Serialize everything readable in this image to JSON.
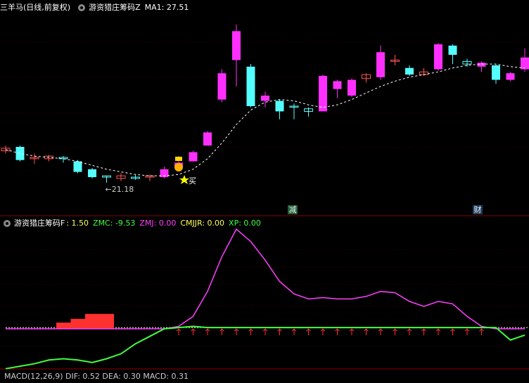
{
  "main_pane": {
    "stock_title": "三羊马(日线,前复权)",
    "indicator_name": "游资猎庄筹码Z",
    "ma_label": "MA1: 27.51",
    "low_marker": "←21.18",
    "buy_label": "买",
    "event_badges": [
      "减",
      "财"
    ]
  },
  "sub_pane": {
    "indicator_name": "游资猎庄筹码F",
    "items": [
      {
        "text": ": 1.50",
        "color": "#ffff54"
      },
      {
        "text": "ZMC: -9.53",
        "color": "#40ff40"
      },
      {
        "text": "ZMJ: 0.00",
        "color": "#ff40ff"
      },
      {
        "text": "CMJJR: 0.00",
        "color": "#ffff54"
      },
      {
        "text": "XP: 0.00",
        "color": "#40ff40"
      }
    ]
  },
  "bottom_pane": {
    "partial_legend": "MACD(12,26,9) DIF: 0.52 DEA: 0.30 MACD: 0.31"
  },
  "colors": {
    "up": "#ff30ff",
    "down": "#54ffff",
    "flat_up": "#ff5454",
    "ma": "#ffffff",
    "zmj": "#ff40ff",
    "zmc": "#40ff40",
    "signal": "#ff3030",
    "frame": "#8b0000"
  },
  "chart_data": [
    {
      "type": "candlestick",
      "series": "price",
      "candles": [
        {
          "o": 23.6,
          "c": 23.8,
          "h": 24.0,
          "l": 23.4
        },
        {
          "o": 23.9,
          "c": 22.9,
          "h": 24.0,
          "l": 22.8
        },
        {
          "o": 23.0,
          "c": 23.1,
          "h": 23.4,
          "l": 22.6
        },
        {
          "o": 23.0,
          "c": 23.2,
          "h": 23.3,
          "l": 22.8
        },
        {
          "o": 23.1,
          "c": 23.0,
          "h": 23.2,
          "l": 22.7
        },
        {
          "o": 22.8,
          "c": 22.0,
          "h": 22.9,
          "l": 21.9
        },
        {
          "o": 22.2,
          "c": 21.6,
          "h": 22.3,
          "l": 21.5
        },
        {
          "o": 21.7,
          "c": 21.6,
          "h": 21.7,
          "l": 21.18
        },
        {
          "o": 21.5,
          "c": 21.7,
          "h": 21.9,
          "l": 21.3
        },
        {
          "o": 21.6,
          "c": 21.5,
          "h": 21.8,
          "l": 21.4
        },
        {
          "o": 21.6,
          "c": 21.7,
          "h": 21.8,
          "l": 21.3
        },
        {
          "o": 21.6,
          "c": 22.2,
          "h": 22.4,
          "l": 21.5
        },
        {
          "o": 22.3,
          "c": 22.7,
          "h": 23.2,
          "l": 22.2
        },
        {
          "o": 22.8,
          "c": 23.5,
          "h": 23.6,
          "l": 22.8
        },
        {
          "o": 24.0,
          "c": 25.0,
          "h": 25.1,
          "l": 24.0
        },
        {
          "o": 27.5,
          "c": 29.5,
          "h": 29.8,
          "l": 27.3
        },
        {
          "o": 30.5,
          "c": 32.7,
          "h": 33.2,
          "l": 28.5
        },
        {
          "o": 30.0,
          "c": 27.0,
          "h": 30.2,
          "l": 26.9
        },
        {
          "o": 27.4,
          "c": 27.8,
          "h": 28.1,
          "l": 26.9
        },
        {
          "o": 27.4,
          "c": 26.6,
          "h": 27.5,
          "l": 26.0
        },
        {
          "o": 27.0,
          "c": 27.0,
          "h": 27.2,
          "l": 26.0
        },
        {
          "o": 26.8,
          "c": 26.6,
          "h": 26.9,
          "l": 26.2
        },
        {
          "o": 26.6,
          "c": 29.3,
          "h": 29.4,
          "l": 26.6
        },
        {
          "o": 28.3,
          "c": 28.9,
          "h": 29.0,
          "l": 27.6
        },
        {
          "o": 27.8,
          "c": 29.0,
          "h": 29.1,
          "l": 27.7
        },
        {
          "o": 29.1,
          "c": 29.4,
          "h": 29.5,
          "l": 28.8
        },
        {
          "o": 29.2,
          "c": 31.1,
          "h": 31.6,
          "l": 29.0
        },
        {
          "o": 30.4,
          "c": 30.5,
          "h": 30.9,
          "l": 30.1
        },
        {
          "o": 29.9,
          "c": 29.4,
          "h": 30.1,
          "l": 29.3
        },
        {
          "o": 29.4,
          "c": 29.6,
          "h": 29.9,
          "l": 29.3
        },
        {
          "o": 29.8,
          "c": 31.7,
          "h": 31.8,
          "l": 29.7
        },
        {
          "o": 31.6,
          "c": 30.9,
          "h": 31.7,
          "l": 30.2
        },
        {
          "o": 30.4,
          "c": 30.2,
          "h": 30.6,
          "l": 30.0
        },
        {
          "o": 30.0,
          "c": 30.3,
          "h": 30.4,
          "l": 29.6
        },
        {
          "o": 30.1,
          "c": 29.0,
          "h": 30.2,
          "l": 28.7
        },
        {
          "o": 29.0,
          "c": 29.5,
          "h": 29.6,
          "l": 28.9
        },
        {
          "o": 29.8,
          "c": 30.7,
          "h": 31.4,
          "l": 29.6
        }
      ],
      "ma": [
        23.7,
        23.4,
        23.2,
        23.1,
        23.0,
        22.8,
        22.5,
        22.2,
        22.0,
        21.8,
        21.7,
        21.7,
        21.8,
        22.2,
        23.0,
        24.2,
        25.6,
        26.7,
        27.3,
        27.5,
        27.4,
        27.1,
        26.9,
        27.1,
        27.5,
        28.0,
        28.5,
        28.9,
        29.2,
        29.4,
        29.6,
        29.9,
        30.1,
        30.2,
        30.2,
        30.0,
        29.9
      ],
      "ylim": [
        20.0,
        34.0
      ]
    },
    {
      "type": "line",
      "series": "ZMJ / ZMC",
      "zmj": [
        0,
        0,
        0,
        0,
        0,
        0,
        0,
        0,
        0,
        0,
        0,
        0,
        2,
        10,
        30,
        58,
        80,
        70,
        55,
        38,
        28,
        24,
        25,
        24,
        24,
        26,
        30,
        29,
        22,
        18,
        22,
        20,
        10,
        2,
        0,
        0,
        0
      ],
      "zmc": [
        -32,
        -30,
        -28,
        -25,
        -24,
        -25,
        -27,
        -24,
        -20,
        -12,
        -6,
        0,
        1,
        2,
        1,
        1,
        1,
        1,
        1,
        1,
        1,
        1,
        1,
        1,
        1,
        1,
        1,
        1,
        1,
        1,
        1,
        1,
        1,
        1,
        1,
        -9,
        -5
      ],
      "chips": [
        0,
        0,
        0,
        0,
        5,
        8,
        12,
        12,
        0,
        0,
        0,
        0,
        0,
        0,
        0,
        0,
        0,
        0,
        0,
        0,
        0,
        0,
        0,
        0,
        0,
        0,
        0,
        0,
        0,
        0,
        0,
        0,
        0,
        0,
        0,
        0,
        0
      ],
      "ylim": [
        -35,
        80
      ]
    }
  ]
}
